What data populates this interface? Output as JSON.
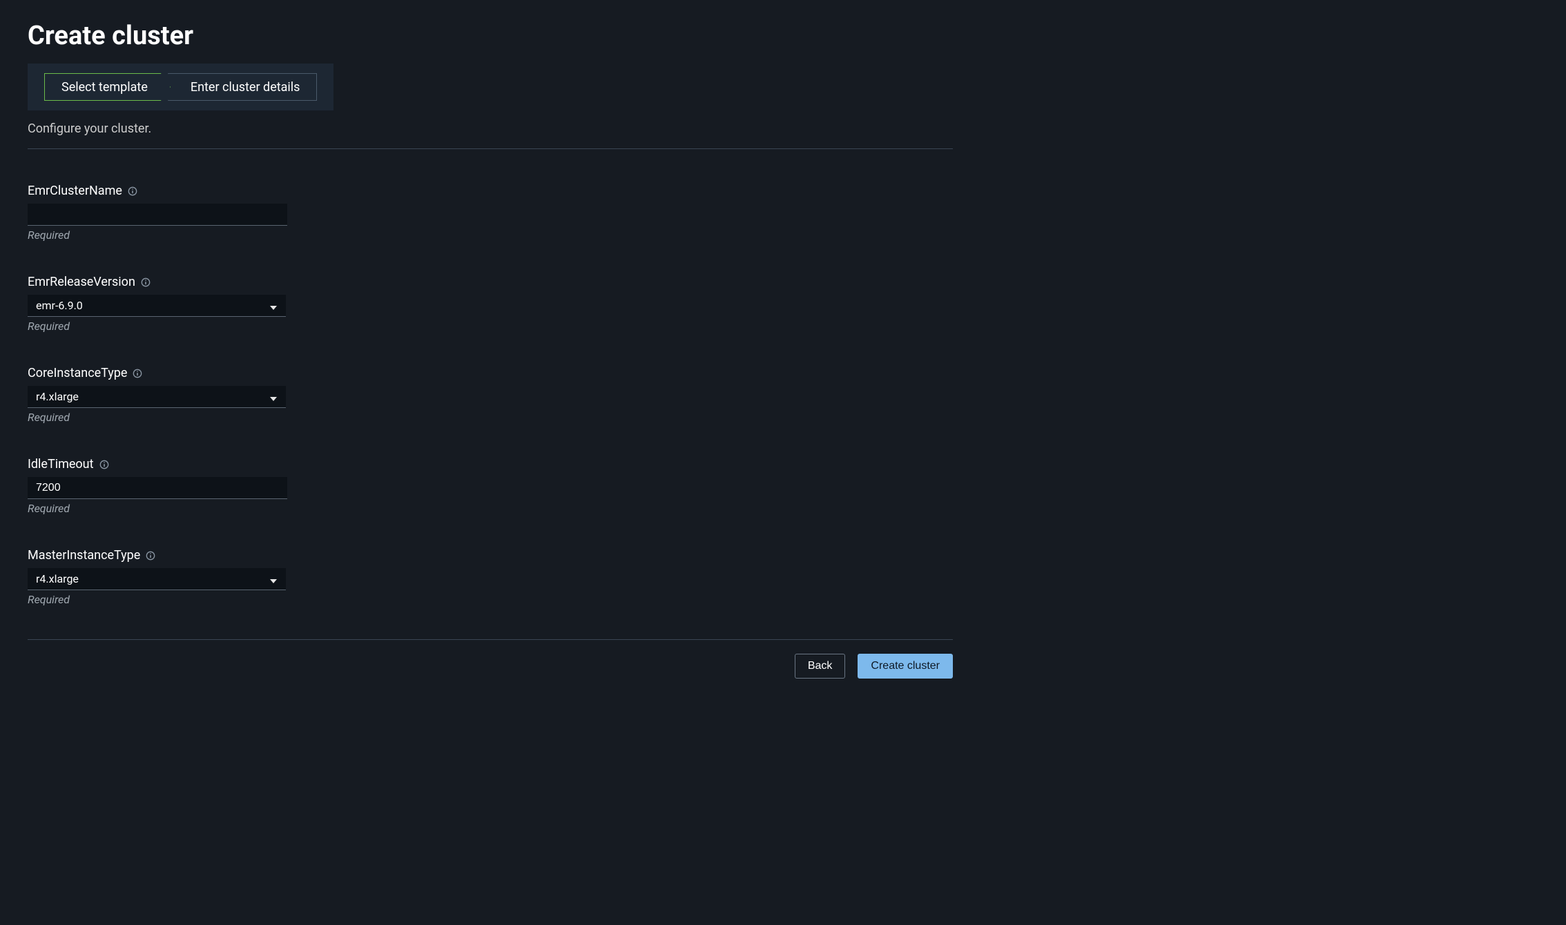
{
  "page": {
    "title": "Create cluster",
    "subtitle": "Configure your cluster."
  },
  "stepper": {
    "step1": "Select template",
    "step2": "Enter cluster details"
  },
  "fields": {
    "clusterName": {
      "label": "EmrClusterName",
      "value": "",
      "helper": "Required"
    },
    "releaseVersion": {
      "label": "EmrReleaseVersion",
      "value": "emr-6.9.0",
      "helper": "Required"
    },
    "coreInstanceType": {
      "label": "CoreInstanceType",
      "value": "r4.xlarge",
      "helper": "Required"
    },
    "idleTimeout": {
      "label": "IdleTimeout",
      "value": "7200",
      "helper": "Required"
    },
    "masterInstanceType": {
      "label": "MasterInstanceType",
      "value": "r4.xlarge",
      "helper": "Required"
    }
  },
  "buttons": {
    "back": "Back",
    "create": "Create cluster"
  }
}
